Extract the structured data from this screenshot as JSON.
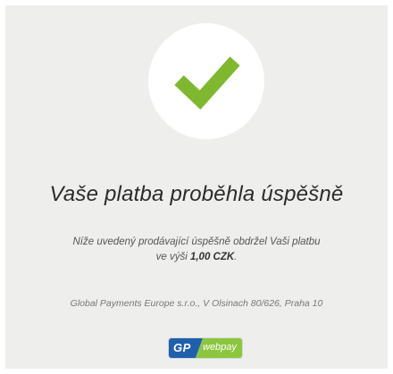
{
  "page": {
    "title": "Vaše platba proběhla úspěšně",
    "message_line1": "Níže uvedený prodávající úspěšně obdržel Vaši platbu",
    "message_line2_prefix": "ve výši ",
    "amount": "1,00 CZK",
    "message_line2_suffix": ".",
    "company": "Global Payments Europe s.r.o., V Olsinach 80/626, Praha 10"
  },
  "logo": {
    "gp_text": "GP",
    "webpay_text": "webpay"
  },
  "icons": {
    "success": "checkmark-icon"
  },
  "colors": {
    "background": "#eeeeec",
    "check": "#7fb82e",
    "logo_blue": "#1f5fae",
    "logo_green": "#8cc63e"
  }
}
